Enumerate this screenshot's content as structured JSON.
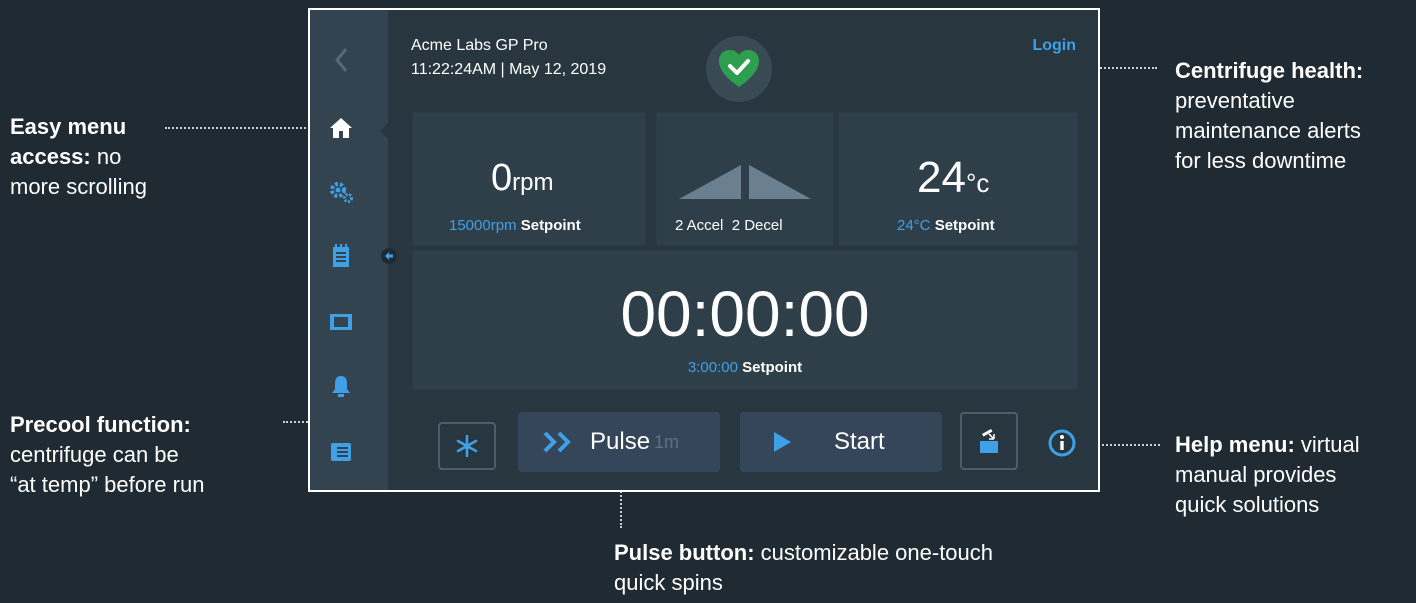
{
  "header": {
    "app_name": "Acme Labs GP Pro",
    "datetime": "11:22:24AM | May 12, 2019",
    "login_label": "Login"
  },
  "sidebar": {
    "items": [
      "back-icon",
      "home-icon",
      "settings-icon",
      "clipboard-icon",
      "film-icon",
      "bell-icon",
      "program-icon"
    ]
  },
  "speed": {
    "value": "0",
    "unit": "rpm",
    "setpoint_value": "15000rpm",
    "setpoint_label": "Setpoint"
  },
  "ramp": {
    "accel": "2 Accel",
    "decel": "2 Decel"
  },
  "temperature": {
    "value": "24",
    "unit": "°c",
    "setpoint_value": "24°C",
    "setpoint_label": "Setpoint"
  },
  "timer": {
    "value": "00:00:00",
    "setpoint_value": "3:00:00",
    "setpoint_label": "Setpoint"
  },
  "buttons": {
    "pulse_label": "Pulse",
    "pulse_duration": "1m",
    "start_label": "Start"
  },
  "annotations": {
    "menu": {
      "bold": "Easy menu",
      "bold2": "access:",
      "rest1": " no",
      "rest2": "more scrolling"
    },
    "precool": {
      "bold": "Precool function:",
      "line2": "centrifuge can be",
      "line3": "“at temp” before run"
    },
    "pulse": {
      "bold": "Pulse button:",
      "rest": " customizable one-touch",
      "line2": "quick spins"
    },
    "health": {
      "bold": "Centrifuge health:",
      "line2": "preventative",
      "line3": "maintenance alerts",
      "line4": "for less downtime"
    },
    "help": {
      "bold": "Help menu:",
      "rest": " virtual",
      "line2": "manual provides",
      "line3": "quick solutions"
    }
  },
  "colors": {
    "accent_blue": "#3fa0e6",
    "health_green": "#2e9e4f",
    "background": "#1f2a33"
  }
}
